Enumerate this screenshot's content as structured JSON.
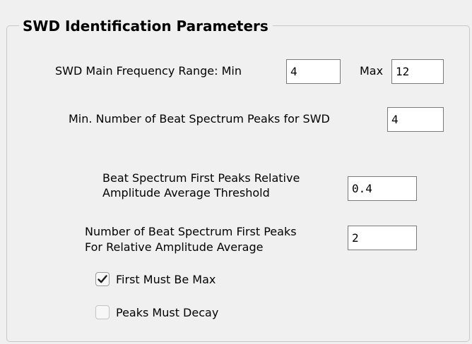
{
  "group": {
    "title": "SWD Identification Parameters"
  },
  "freq_range": {
    "label_min": "SWD Main Frequency Range: Min",
    "min_value": "4",
    "label_max": "Max",
    "max_value": "12"
  },
  "min_peaks": {
    "label": "Min. Number of Beat Spectrum Peaks for SWD",
    "value": "4"
  },
  "rel_amp_threshold": {
    "label_line1": "Beat Spectrum First Peaks Relative",
    "label_line2": "Amplitude Average Threshold",
    "value": "0.4"
  },
  "num_first_peaks": {
    "label_line1": "Number of Beat Spectrum First Peaks",
    "label_line2": "For Relative Amplitude Average",
    "value": "2"
  },
  "checkboxes": {
    "first_must_be_max": {
      "label": "First Must Be Max",
      "checked": true,
      "icon": "checkmark-icon"
    },
    "peaks_must_decay": {
      "label": "Peaks Must Decay",
      "checked": false
    }
  }
}
